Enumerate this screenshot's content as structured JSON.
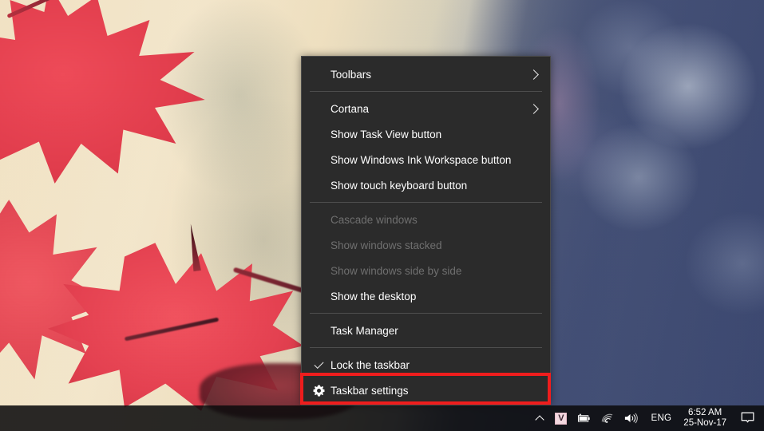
{
  "desktop": {
    "wallpaper_description": "Blurred photo of red maple leaves on cream and blue bokeh background",
    "colors": {
      "leaf_red": "#e8404f",
      "wallpaper_cream": "#f2e3c4",
      "wallpaper_blue": "#46537f",
      "menu_background": "#2b2b2b",
      "menu_border": "#4a4a4a",
      "menu_text": "#ffffff",
      "menu_text_disabled": "#6f6f6f",
      "separator": "#4e4e4e",
      "highlight_red": "#ef1d1d",
      "taskbar_background": "#0c0c0e"
    }
  },
  "context_menu": {
    "name": "taskbar-context-menu",
    "groups": [
      {
        "items": [
          {
            "label": "Toolbars",
            "submenu": true,
            "disabled": false,
            "icon": "",
            "checked": false
          }
        ]
      },
      {
        "items": [
          {
            "label": "Cortana",
            "submenu": true,
            "disabled": false,
            "icon": "",
            "checked": false
          },
          {
            "label": "Show Task View button",
            "submenu": false,
            "disabled": false,
            "icon": "",
            "checked": false
          },
          {
            "label": "Show Windows Ink Workspace button",
            "submenu": false,
            "disabled": false,
            "icon": "",
            "checked": false
          },
          {
            "label": "Show touch keyboard button",
            "submenu": false,
            "disabled": false,
            "icon": "",
            "checked": false
          }
        ]
      },
      {
        "items": [
          {
            "label": "Cascade windows",
            "submenu": false,
            "disabled": true,
            "icon": "",
            "checked": false
          },
          {
            "label": "Show windows stacked",
            "submenu": false,
            "disabled": true,
            "icon": "",
            "checked": false
          },
          {
            "label": "Show windows side by side",
            "submenu": false,
            "disabled": true,
            "icon": "",
            "checked": false
          },
          {
            "label": "Show the desktop",
            "submenu": false,
            "disabled": false,
            "icon": "",
            "checked": false
          }
        ]
      },
      {
        "items": [
          {
            "label": "Task Manager",
            "submenu": false,
            "disabled": false,
            "icon": "",
            "checked": false
          }
        ]
      },
      {
        "items": [
          {
            "label": "Lock the taskbar",
            "submenu": false,
            "disabled": false,
            "icon": "check-icon",
            "checked": true
          },
          {
            "label": "Taskbar settings",
            "submenu": false,
            "disabled": false,
            "icon": "gear-icon",
            "checked": false,
            "highlighted": true
          }
        ]
      }
    ]
  },
  "taskbar": {
    "tray": {
      "expand_icon": "chevron-up-icon",
      "icons": [
        {
          "name": "vivaldi-icon",
          "glyph": "V"
        },
        {
          "name": "battery-icon",
          "glyph": ""
        },
        {
          "name": "wifi-icon",
          "glyph": ""
        },
        {
          "name": "volume-icon",
          "glyph": ""
        }
      ],
      "language": "ENG",
      "clock": {
        "time": "6:52 AM",
        "date": "25-Nov-17"
      },
      "action_center_icon": "speech-bubble-icon"
    }
  }
}
